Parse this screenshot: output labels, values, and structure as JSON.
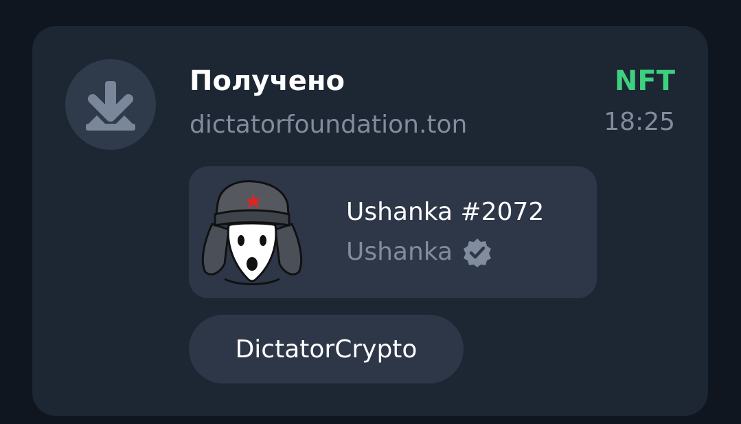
{
  "transaction": {
    "icon": "download-icon",
    "title": "Получено",
    "sender": "dictatorfoundation.ton",
    "type_label": "NFT",
    "time": "18:25"
  },
  "nft": {
    "name": "Ushanka #2072",
    "collection": "Ushanka",
    "verified_icon": "verified-badge-icon",
    "image": "ushanka-dog-image"
  },
  "comment": {
    "text": "DictatorCrypto"
  },
  "colors": {
    "background": "#10161f",
    "card": "#1d2633",
    "inner_card": "#2d3748",
    "accent_green": "#3dd07f",
    "secondary_text": "#818d9e"
  }
}
